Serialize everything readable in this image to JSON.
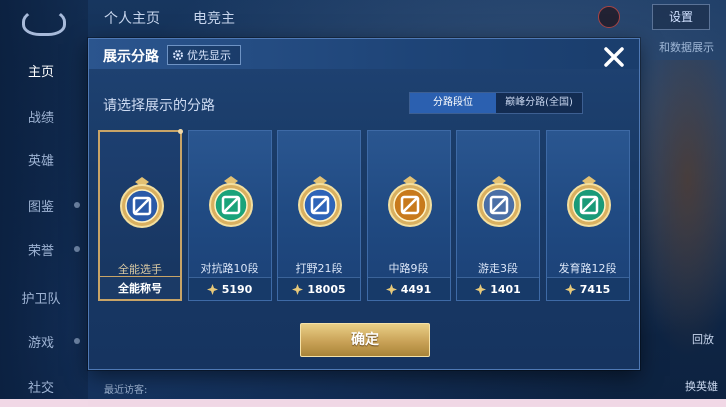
{
  "nav": {
    "items": [
      "主页",
      "战绩",
      "英雄",
      "图鉴",
      "荣誉",
      "护卫队",
      "游戏",
      "社交"
    ]
  },
  "top": {
    "tab_profile": "个人主页",
    "tab_esports": "电竞主",
    "settings": "设置",
    "caption": "和数据展示"
  },
  "side": {
    "report": "回放",
    "switch_hero": "换英雄"
  },
  "bottom": {
    "recent_visitors": "最近访客:"
  },
  "dialog": {
    "title": "展示分路",
    "priority_button": "优先显示",
    "subtitle": "请选择展示的分路",
    "segment": {
      "active": "分路段位",
      "inactive": "巅峰分路(全国)"
    },
    "cards": [
      {
        "name": "全能选手",
        "value": "全能称号",
        "selected": true,
        "badge": "allround-badge-icon",
        "color": "#2a5aa8"
      },
      {
        "name": "对抗路10段",
        "value": "5190",
        "badge": "clash-lane-badge-icon",
        "color": "#1aa37a"
      },
      {
        "name": "打野21段",
        "value": "18005",
        "badge": "jungle-badge-icon",
        "color": "#2e64b8"
      },
      {
        "name": "中路9段",
        "value": "4491",
        "badge": "mid-lane-badge-icon",
        "color": "#c87a1c"
      },
      {
        "name": "游走3段",
        "value": "1401",
        "badge": "roam-badge-icon",
        "color": "#4a6fa6"
      },
      {
        "name": "发育路12段",
        "value": "7415",
        "badge": "farm-lane-badge-icon",
        "color": "#1a9a78"
      }
    ],
    "confirm": "确定"
  },
  "colors": {
    "gold": "#c8a467",
    "accent": "#2b60b0"
  }
}
